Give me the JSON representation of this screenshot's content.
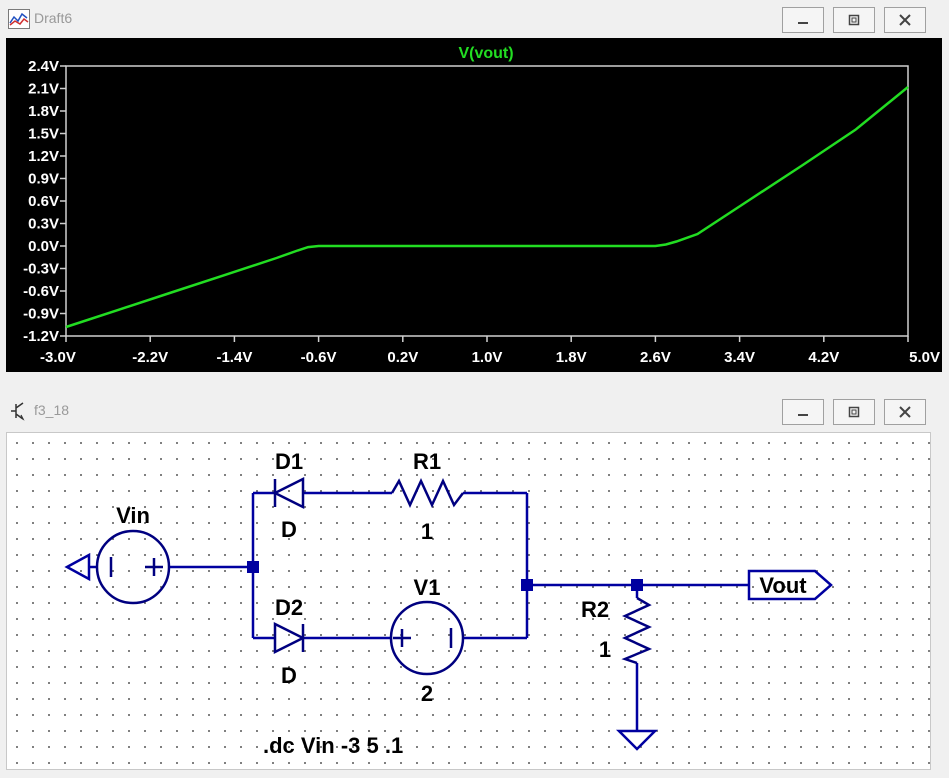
{
  "plot_window": {
    "title": "Draft6",
    "trace_label": "V(vout)",
    "trace_color": "#22dd22",
    "x_ticks": [
      "-3.0V",
      "-2.2V",
      "-1.4V",
      "-0.6V",
      "0.2V",
      "1.0V",
      "1.8V",
      "2.6V",
      "3.4V",
      "4.2V",
      "5.0V"
    ],
    "y_ticks": [
      "2.4V",
      "2.1V",
      "1.8V",
      "1.5V",
      "1.2V",
      "0.9V",
      "0.6V",
      "0.3V",
      "0.0V",
      "-0.3V",
      "-0.6V",
      "-0.9V",
      "-1.2V"
    ]
  },
  "chart_data": {
    "type": "line",
    "title": "V(vout)",
    "xlabel": "",
    "ylabel": "",
    "xlim": [
      -3.0,
      5.0
    ],
    "ylim": [
      -1.2,
      2.4
    ],
    "grid": false,
    "series": [
      {
        "name": "V(vout)",
        "color": "#22dd22",
        "x": [
          -3.0,
          -2.5,
          -2.0,
          -1.5,
          -1.0,
          -0.8,
          -0.7,
          -0.6,
          0.0,
          1.0,
          2.0,
          2.6,
          2.7,
          2.8,
          3.0,
          3.5,
          4.0,
          4.5,
          5.0
        ],
        "y": [
          -1.08,
          -0.85,
          -0.62,
          -0.39,
          -0.16,
          -0.06,
          -0.015,
          0.0,
          0.0,
          0.0,
          0.0,
          0.0,
          0.02,
          0.06,
          0.16,
          0.62,
          1.08,
          1.55,
          2.12
        ]
      }
    ]
  },
  "schematic_window": {
    "title": "f3_18",
    "labels": {
      "vin": "Vin",
      "d1": "D1",
      "d1_model": "D",
      "r1": "R1",
      "r1_value": "1",
      "d2": "D2",
      "d2_model": "D",
      "v1": "V1",
      "v1_value": "2",
      "r2": "R2",
      "r2_value": "1",
      "vout": "Vout",
      "directive": ".dc Vin -3 5 .1"
    },
    "wire_color": "#0000a0",
    "symbol_color": "#000080"
  }
}
